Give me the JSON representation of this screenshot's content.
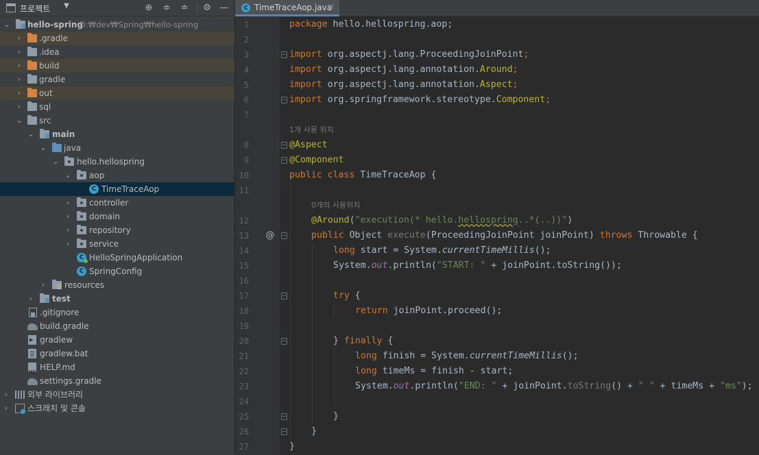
{
  "project_panel": {
    "title": "프로젝트",
    "tree": [
      {
        "label": "hello-spring",
        "path": "D:₩dev₩Spring₩hello-spring",
        "icon": "module-folder-icon",
        "depth": 0,
        "expanded": true,
        "bold": true
      },
      {
        "label": ".gradle",
        "icon": "excluded-folder-icon",
        "depth": 1,
        "expanded": false,
        "excluded": true
      },
      {
        "label": ".idea",
        "icon": "folder-icon",
        "depth": 1,
        "expanded": false
      },
      {
        "label": "build",
        "icon": "excluded-folder-icon",
        "depth": 1,
        "expanded": false,
        "excluded": true
      },
      {
        "label": "gradle",
        "icon": "folder-icon",
        "depth": 1,
        "expanded": false
      },
      {
        "label": "out",
        "icon": "excluded-folder-icon",
        "depth": 1,
        "expanded": false,
        "excluded": true
      },
      {
        "label": "sql",
        "icon": "folder-icon",
        "depth": 1,
        "expanded": false
      },
      {
        "label": "src",
        "icon": "folder-icon",
        "depth": 1,
        "expanded": true
      },
      {
        "label": "main",
        "icon": "module-folder-icon",
        "depth": 2,
        "expanded": true,
        "bold": true
      },
      {
        "label": "java",
        "icon": "source-folder-icon",
        "depth": 3,
        "expanded": true
      },
      {
        "label": "hello.hellospring",
        "icon": "package-icon",
        "depth": 4,
        "expanded": true
      },
      {
        "label": "aop",
        "icon": "package-icon",
        "depth": 5,
        "expanded": true
      },
      {
        "label": "TimeTraceAop",
        "icon": "class-icon",
        "depth": 6,
        "selected": true
      },
      {
        "label": "controller",
        "icon": "package-icon",
        "depth": 5,
        "expanded": false
      },
      {
        "label": "domain",
        "icon": "package-icon",
        "depth": 5,
        "expanded": false
      },
      {
        "label": "repository",
        "icon": "package-icon",
        "depth": 5,
        "expanded": false
      },
      {
        "label": "service",
        "icon": "package-icon",
        "depth": 5,
        "expanded": false
      },
      {
        "label": "HelloSpringApplication",
        "icon": "spring-class-icon",
        "depth": 5
      },
      {
        "label": "SpringConfig",
        "icon": "class-icon",
        "depth": 5
      },
      {
        "label": "resources",
        "icon": "resources-folder-icon",
        "depth": 3,
        "expanded": false
      },
      {
        "label": "test",
        "icon": "module-folder-icon",
        "depth": 2,
        "expanded": false,
        "bold": true
      },
      {
        "label": ".gitignore",
        "icon": "gitignore-file-icon",
        "depth": 1
      },
      {
        "label": "build.gradle",
        "icon": "gradle-file-icon",
        "depth": 1
      },
      {
        "label": "gradlew",
        "icon": "shell-file-icon",
        "depth": 1
      },
      {
        "label": "gradlew.bat",
        "icon": "bat-file-icon",
        "depth": 1
      },
      {
        "label": "HELP.md",
        "icon": "markdown-file-icon",
        "depth": 1
      },
      {
        "label": "settings.gradle",
        "icon": "gradle-file-icon",
        "depth": 1
      },
      {
        "label": "외부 라이브러리",
        "icon": "library-icon",
        "depth": 0,
        "expanded": false
      },
      {
        "label": "스크래치 및 콘솔",
        "icon": "scratch-icon",
        "depth": 0,
        "expanded": false
      }
    ]
  },
  "editor": {
    "tab_label": "TimeTraceAop.java",
    "hints": {
      "class_usage": "1개 사용 위치",
      "method_usage": "0개의 사용위치"
    },
    "line_numbers": [
      "1",
      "2",
      "3",
      "4",
      "5",
      "6",
      "7",
      "8",
      "9",
      "10",
      "11",
      "12",
      "13",
      "14",
      "15",
      "16",
      "17",
      "18",
      "19",
      "20",
      "21",
      "22",
      "23",
      "24",
      "25",
      "26",
      "27"
    ],
    "gutter_marker": "@",
    "code": {
      "l1": {
        "kw": "package",
        "rest": " hello.hellospring.aop;"
      },
      "l3": {
        "kw": "import",
        "pkg": " org.aspectj.lang.ProceedingJoinPoint",
        "semi": ";"
      },
      "l4": {
        "kw": "import",
        "pkg": " org.aspectj.lang.annotation.",
        "cls": "Around",
        "semi": ";"
      },
      "l5": {
        "kw": "import",
        "pkg": " org.aspectj.lang.annotation.",
        "cls": "Aspect",
        "semi": ";"
      },
      "l6": {
        "kw": "import",
        "pkg": " org.springframework.stereotype.",
        "cls": "Component",
        "semi": ";"
      },
      "l8": {
        "ann": "@Aspect"
      },
      "l9": {
        "ann": "@Component"
      },
      "l10": {
        "kw1": "public",
        "kw2": "class",
        "name": " TimeTraceAop {"
      },
      "l12": {
        "ann": "@Around",
        "p1": "(",
        "s1": "\"execution(* hello.",
        "s2": "hellospring",
        "s3": "..*(..))\"",
        "p2": ")"
      },
      "l13": {
        "kw": "public",
        "t1": " Object ",
        "m": "execute",
        "t2": "(ProceedingJoinPoint joinPoint) ",
        "kw2": "throws",
        "t3": " Throwable {"
      },
      "l14": {
        "kw": "long",
        "t1": " start = System.",
        "st": "currentTimeMillis",
        "t2": "();"
      },
      "l15": {
        "t1": "System.",
        "f": "out",
        "t2": ".println(",
        "s": "\"START: \"",
        "t3": " + joinPoint.toString());"
      },
      "l17": {
        "kw": "try",
        "t": " {"
      },
      "l18": {
        "kw": "return",
        "t": " joinPoint.proceed();"
      },
      "l20": {
        "t": "} ",
        "kw": "finally",
        "t2": " {"
      },
      "l21": {
        "kw": "long",
        "t1": " finish = System.",
        "st": "currentTimeMillis",
        "t2": "();"
      },
      "l22": {
        "kw": "long",
        "t1": " timeMs = finish - start;"
      },
      "l23": {
        "t1": "System.",
        "f": "out",
        "t2": ".println(",
        "s1": "\"END: \"",
        "t3": " + joinPoint.",
        "m": "toString",
        "t4": "() + ",
        "s2": "\" \"",
        "t5": " + timeMs + ",
        "s3": "\"ms\"",
        "t6": ");"
      },
      "l25": {
        "t": "}"
      },
      "l26": {
        "t": "}"
      },
      "l27": {
        "t": "}"
      }
    }
  },
  "colors": {
    "background": "#2b2b2b",
    "panel": "#3c3f41",
    "keyword": "#cc7832",
    "string": "#6a8759",
    "annotation": "#bbb529",
    "field": "#9876aa",
    "selection": "#0d293e",
    "excluded_row": "#49443a"
  }
}
